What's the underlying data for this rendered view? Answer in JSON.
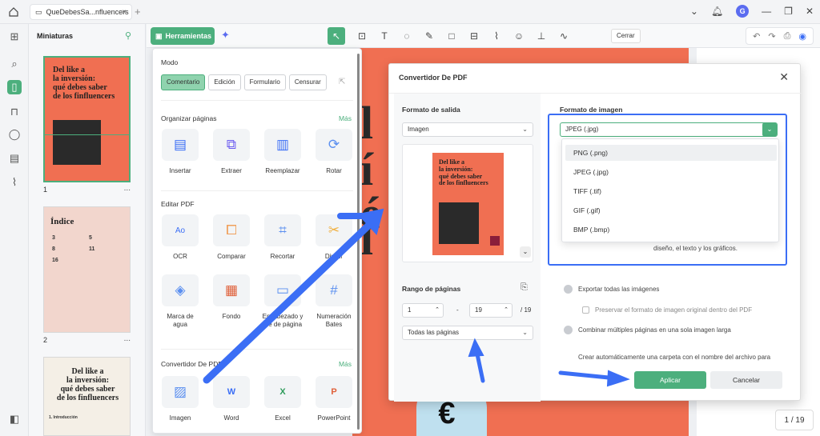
{
  "titlebar": {
    "tab_title": "QueDebesSa...nfluencers",
    "tab_close": "×",
    "tab_add": "+",
    "avatar_letter": "G"
  },
  "thumbnails": {
    "title": "Miniaturas",
    "pages": [
      {
        "num": "1",
        "menu": "...",
        "title_lines": [
          "Del like a",
          "la inversión:",
          "qué debes saber",
          "de los finfluencers"
        ]
      },
      {
        "num": "2",
        "menu": "...",
        "title": "Índice",
        "items": [
          "3",
          "5",
          "8",
          "11",
          "16"
        ]
      },
      {
        "num": "",
        "menu": "",
        "title_lines": [
          "Del like a",
          "la inversión:",
          "qué debes saber",
          "de los finfluencers"
        ],
        "subtitle": "1. Introducción"
      }
    ]
  },
  "toolbar": {
    "tools_label": "Herramientas",
    "close_label": "Cerrar"
  },
  "tools_menu": {
    "mode_title": "Modo",
    "modes": [
      "Comentario",
      "Edición",
      "Formulario",
      "Censurar"
    ],
    "organize_title": "Organizar páginas",
    "more": "Más",
    "organize_tools": [
      "Insertar",
      "Extraer",
      "Reemplazar",
      "Rotar"
    ],
    "edit_title": "Editar PDF",
    "edit_tools": [
      "OCR",
      "Comparar",
      "Recortar",
      "Dividir",
      "Marca de agua",
      "Fondo",
      "Encabezado y pie de página",
      "Numeración Bates"
    ],
    "convert_title": "Convertidor De PDF",
    "convert_tools": [
      "Imagen",
      "Word",
      "Excel",
      "PowerPoint"
    ]
  },
  "document": {
    "page_indicator": "1 / 19",
    "euro": "€"
  },
  "dialog": {
    "title": "Convertidor De PDF",
    "output_format_label": "Formato de salida",
    "output_format_value": "Imagen",
    "preview_title_lines": [
      "Del like a",
      "la inversión:",
      "qué debes saber",
      "de los finfluencers"
    ],
    "page_range_label": "Rango de páginas",
    "range_from": "1",
    "range_to": "19",
    "range_total": "/ 19",
    "range_dash": "-",
    "pages_option": "Todas las páginas",
    "image_format_label": "Formato de imagen",
    "image_format_value": "JPEG (.jpg)",
    "format_options": [
      "PNG (.png)",
      "JPEG (.jpg)",
      "TIFF (.tif)",
      "GIF (.gif)",
      "BMP (.bmp)"
    ],
    "hidden_desc": "diseño, el texto y los gráficos.",
    "export_all": "Exportar todas las imágenes",
    "preserve_format": "Preservar el formato de imagen original dentro del PDF",
    "combine": "Combinar múltiples páginas en una sola imagen larga",
    "auto_folder": "Crear automáticamente una carpeta con el nombre del archivo para",
    "apply": "Aplicar",
    "cancel": "Cancelar"
  },
  "colors": {
    "accent": "#4caf7d",
    "highlight": "#3b6ef5",
    "doc_bg": "#f06f52"
  }
}
